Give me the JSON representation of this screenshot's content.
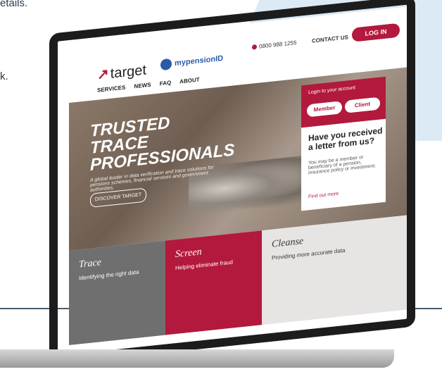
{
  "top_text": {
    "line1": "etails.",
    "line2": "k."
  },
  "site": {
    "logo": "target",
    "mypension": "mypensionID",
    "phone": "0800 988 1255",
    "contact": "CONTACT US",
    "login": "LOG IN",
    "nav": [
      "SERVICES",
      "NEWS",
      "FAQ",
      "ABOUT"
    ]
  },
  "hero": {
    "title_lines": [
      "TRUSTED",
      "TRACE",
      "PROFESSIONALS"
    ],
    "subtitle": "A global leader in data verification and trace solutions for pensions schemes, financial services and government authorities.",
    "button": "DISCOVER TARGET"
  },
  "login_panel": {
    "title": "Login to your account",
    "member": "Member",
    "client": "Client"
  },
  "letter_card": {
    "title": "Have you received a letter from us?",
    "body": "You may be a member or beneficiary of a pension, insurance policy or investment.",
    "link": "Find out more"
  },
  "tiles": [
    {
      "title": "Trace",
      "subtitle": "Identifying the right data"
    },
    {
      "title": "Screen",
      "subtitle": "Helping eliminate fraud"
    },
    {
      "title": "Cleanse",
      "subtitle": "Providing more accurate data"
    }
  ]
}
